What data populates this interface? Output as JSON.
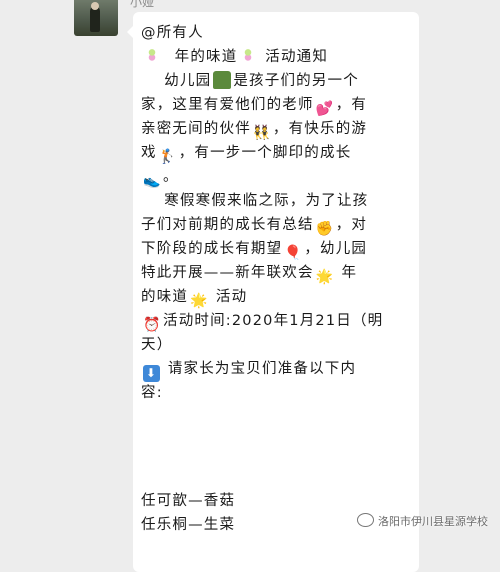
{
  "chat": {
    "sender_name": "小娅",
    "message_lines": [
      "@所有人",
      "年的味道",
      "活动通知",
      "幼儿园",
      "是孩子们的另一个",
      "家，这里有爱他们的老师",
      "，有",
      "亲密无间的伙伴",
      "，有快乐的游",
      "戏",
      "，有一步一个脚印的成长",
      "。",
      "寒假寒假来临之际，为了让孩",
      "子们对前期的成长有总结",
      "，对",
      "下阶段的成长有期望",
      "，幼儿园",
      "特此开展——新年联欢会",
      "年",
      "的味道",
      "活动",
      "活动时间:2020年1月21日（明",
      "天）",
      "请家长为宝贝们准备以下内",
      "容:",
      "任可歆—香菇",
      "任乐桐—生菜"
    ],
    "emoji_icons": [
      "tanghulu-icon",
      "house-icon",
      "hearts-icon",
      "friends-icon",
      "golfer-icon",
      "shoe-icon",
      "fist-icon",
      "balloon-icon",
      "sparkle-star-icon",
      "alarm-clock-icon",
      "down-arrow-icon"
    ]
  },
  "watermark": {
    "text": "洛阳市伊川县星源学校"
  }
}
